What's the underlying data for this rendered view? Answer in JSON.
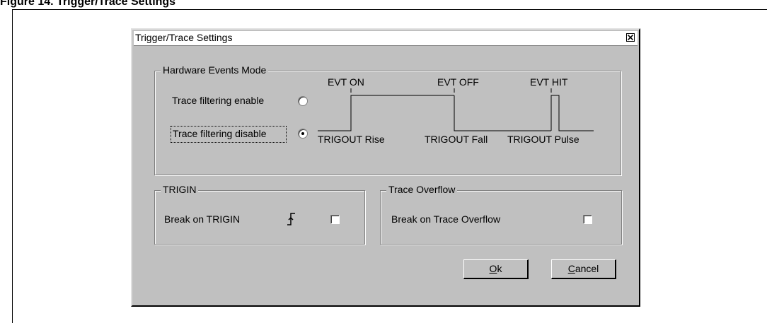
{
  "figure": {
    "caption": "Figure 14. Trigger/Trace Settings"
  },
  "window": {
    "title": "Trigger/Trace Settings"
  },
  "hardware_events": {
    "legend": "Hardware Events Mode",
    "options": [
      {
        "label": "Trace filtering enable",
        "selected": false
      },
      {
        "label": "Trace filtering disable",
        "selected": true
      }
    ],
    "timing": {
      "evt_on": "EVT ON",
      "evt_off": "EVT OFF",
      "evt_hit": "EVT HIT",
      "trigout_rise": "TRIGOUT Rise",
      "trigout_fall": "TRIGOUT Fall",
      "trigout_pulse": "TRIGOUT Pulse"
    }
  },
  "trigin": {
    "legend": "TRIGIN",
    "label": "Break on TRIGIN",
    "checked": false,
    "icon": "rising-edge-icon"
  },
  "trace_overflow": {
    "legend": "Trace Overflow",
    "label": "Break on Trace Overflow",
    "checked": false
  },
  "buttons": {
    "ok": {
      "mnemonic": "O",
      "rest": "k"
    },
    "cancel": {
      "mnemonic": "C",
      "rest": "ancel"
    }
  }
}
